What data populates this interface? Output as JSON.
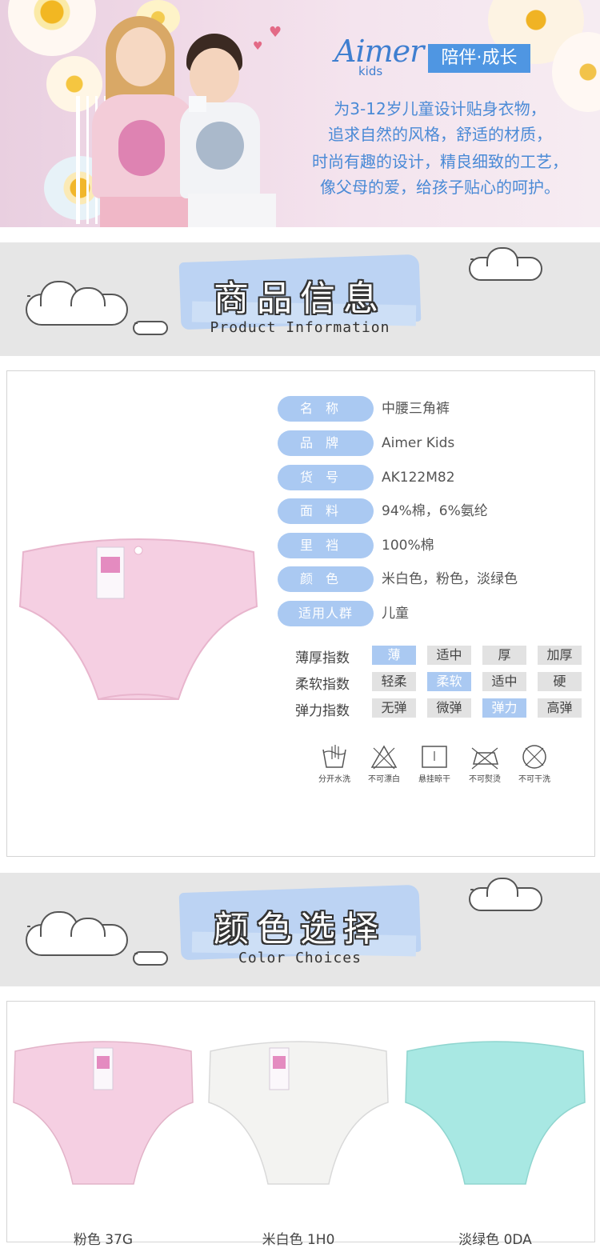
{
  "hero": {
    "brand": "Aimer",
    "brand_sub": "kids",
    "slogan": "陪伴·成长",
    "lines": [
      "为3-12岁儿童设计贴身衣物，",
      "追求自然的风格，舒适的材质，",
      "时尚有趣的设计，精良细致的工艺，",
      "像父母的爱，给孩子贴心的呵护。"
    ]
  },
  "product_info": {
    "title_cn": "商品信息",
    "title_en": "Product Information",
    "attributes": [
      {
        "key": "名称",
        "value": "中腰三角裤"
      },
      {
        "key": "品牌",
        "value": "Aimer Kids"
      },
      {
        "key": "货号",
        "value": "AK122M82"
      },
      {
        "key": "面料",
        "value": "94%棉，6%氨纶"
      },
      {
        "key": "里裆",
        "value": "100%棉"
      },
      {
        "key": "颜色",
        "value": "米白色，粉色，淡绿色"
      },
      {
        "key": "适用人群",
        "value": "儿童"
      }
    ],
    "scales": [
      {
        "label": "薄厚指数",
        "options": [
          "薄",
          "适中",
          "厚",
          "加厚"
        ],
        "selected": 0
      },
      {
        "label": "柔软指数",
        "options": [
          "轻柔",
          "柔软",
          "适中",
          "硬"
        ],
        "selected": 1
      },
      {
        "label": "弹力指数",
        "options": [
          "无弹",
          "微弹",
          "弹力",
          "高弹"
        ],
        "selected": 2
      }
    ],
    "care": [
      {
        "icon": "hand-wash-icon",
        "label": "分开水洗"
      },
      {
        "icon": "no-bleach-icon",
        "label": "不可漂白"
      },
      {
        "icon": "hang-dry-icon",
        "label": "悬挂晾干"
      },
      {
        "icon": "no-iron-icon",
        "label": "不可熨烫"
      },
      {
        "icon": "no-dry-clean-icon",
        "label": "不可干洗"
      }
    ]
  },
  "color_choices": {
    "title_cn": "颜色选择",
    "title_en": "Color Choices",
    "items": [
      {
        "name": "粉色 37G",
        "color": "#f5cfe2"
      },
      {
        "name": "米白色 1H0",
        "color": "#f3f3f1"
      },
      {
        "name": "淡绿色 0DA",
        "color": "#a8e8e3"
      }
    ]
  },
  "colors": {
    "accent": "#4f96e2",
    "key_bg": "#aac9f2",
    "pink": "#f5cfe2"
  }
}
